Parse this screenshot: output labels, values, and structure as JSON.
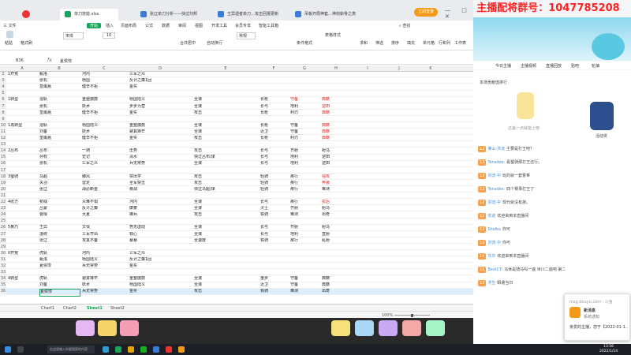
{
  "browser": {
    "tabs": [
      {
        "label": "",
        "active": false
      },
      {
        "label": "单刀技能.xlsx",
        "active": true
      },
      {
        "label": "张辽单刀分析——快过刘邦",
        "active": false
      },
      {
        "label": "王异遗者单刀…攻击回报更新",
        "active": false
      },
      {
        "label": "吊板开局神套…神剑斩骨之类",
        "active": false
      }
    ],
    "login_button": "立即登录",
    "window_controls": "— □ ✕"
  },
  "stream_banner": "主播配将群号：1047785208",
  "menu": {
    "items": [
      "三 文件",
      "开始",
      "插入",
      "页面布局",
      "公式",
      "数据",
      "审阅",
      "视图",
      "开发工具",
      "会员专享",
      "智能工具箱"
    ],
    "search": "查找"
  },
  "ribbon": {
    "labels": [
      "粘贴",
      "格式刷",
      "宋体",
      "10",
      "合并居中",
      "自动换行",
      "常规",
      "条件格式",
      "表格样式",
      "求和",
      "筛选",
      "排序",
      "填充",
      "单元格",
      "行和列",
      "工作表"
    ]
  },
  "formula_bar": {
    "cell": "B36",
    "fx": "fx",
    "value": "夏侯惇"
  },
  "columns": [
    "A",
    "B",
    "C",
    "D",
    "E",
    "F",
    "G",
    "H",
    "I",
    "J",
    "K"
  ],
  "rows": [
    {
      "n": "2",
      "a": "1开荒",
      "b": "甄洛",
      "c": "河内",
      "d": "三军之众",
      "e": "",
      "f": "",
      "g": "",
      "h": ""
    },
    {
      "n": "3",
      "a": "",
      "b": "张机",
      "c": "杨国",
      "d": "反计之策1回",
      "e": "",
      "f": "",
      "g": "",
      "h": ""
    },
    {
      "n": "4",
      "a": "",
      "b": "皇甫嵩",
      "c": "健辛不拒",
      "d": "金实",
      "e": "",
      "f": "",
      "g": "",
      "h": ""
    },
    {
      "n": "5",
      "a": "",
      "b": "",
      "c": "",
      "d": "",
      "e": "",
      "f": "",
      "g": "",
      "h": ""
    },
    {
      "n": "6",
      "a": "1转型",
      "b": "混轨",
      "c": "重整旗鼓",
      "d": "杨国陆义",
      "e": "全谋",
      "f": "长枪",
      "g": "守备",
      "h": "典籍"
    },
    {
      "n": "7",
      "a": "",
      "b": "张机",
      "c": "妖术",
      "d": "步步为营",
      "e": "全谋",
      "f": "长弓",
      "g": "地利",
      "h": "逆田"
    },
    {
      "n": "8",
      "a": "",
      "b": "皇甫嵩",
      "c": "健辛不拒",
      "d": "金实",
      "e": "攻击",
      "f": "长枪",
      "g": "利刃",
      "h": "典籍"
    },
    {
      "n": "9",
      "a": "",
      "b": "",
      "c": "",
      "d": "",
      "e": "",
      "f": "",
      "g": "",
      "h": ""
    },
    {
      "n": "10",
      "a": "1再转型",
      "b": "混轨",
      "c": "杨国陆义",
      "d": "重整旗鼓",
      "e": "全谋",
      "f": "长枪",
      "g": "守备",
      "h": "典籍"
    },
    {
      "n": "11",
      "a": "",
      "b": "刘备",
      "c": "妖术",
      "d": "避其锋芒",
      "e": "全谋",
      "f": "近卫",
      "g": "守备",
      "h": "典籍"
    },
    {
      "n": "12",
      "a": "",
      "b": "皇甫嵩",
      "c": "健辛不拒",
      "d": "金实",
      "e": "攻击",
      "f": "长枪",
      "g": "利刃",
      "h": "典籍"
    },
    {
      "n": "13",
      "a": "",
      "b": "",
      "c": "",
      "d": "",
      "e": "",
      "f": "",
      "g": "",
      "h": ""
    },
    {
      "n": "14",
      "a": "2吕布",
      "b": "吕布",
      "c": "一骑",
      "d": "击势",
      "e": "攻击",
      "f": "长弓",
      "g": "齐射",
      "h": "射马"
    },
    {
      "n": "15",
      "a": "",
      "b": "孙权",
      "c": "史记",
      "d": "清水",
      "e": "快过吕布/谋",
      "f": "长弓",
      "g": "地利",
      "h": "逆田"
    },
    {
      "n": "16",
      "a": "",
      "b": "张机",
      "c": "三军之众",
      "d": "兵无常势",
      "e": "全谋",
      "f": "长弓",
      "g": "地利",
      "h": "逆田"
    },
    {
      "n": "17",
      "a": "",
      "b": "",
      "c": "",
      "d": "",
      "e": "",
      "f": "",
      "g": "",
      "h": ""
    },
    {
      "n": "18",
      "a": "3蜀骑",
      "b": "马超",
      "c": "滕风",
      "d": "突出学",
      "e": "攻击",
      "f": "轻骑",
      "g": "疾行",
      "h": "强攻"
    },
    {
      "n": "19",
      "a": "",
      "b": "关羽",
      "c": "雷定",
      "d": "全军突击",
      "e": "攻击",
      "f": "轻骑",
      "g": "疾行",
      "h": "奔袭"
    },
    {
      "n": "20",
      "a": "",
      "b": "张辽",
      "c": "战必断金",
      "d": "疾战",
      "e": "快过马超/谋",
      "f": "轻骑",
      "g": "疾行",
      "h": "难测"
    },
    {
      "n": "21",
      "a": "",
      "b": "",
      "c": "",
      "d": "",
      "e": "",
      "f": "",
      "g": "",
      "h": ""
    },
    {
      "n": "22",
      "a": "4张方",
      "b": "荀彧",
      "c": "众难不惧",
      "d": "河内",
      "e": "全谋",
      "f": "长弓",
      "g": "疾行",
      "h": "扰后"
    },
    {
      "n": "23",
      "a": "",
      "b": "吕蒙",
      "c": "反计之策",
      "d": "康宴",
      "e": "全谋",
      "f": "灵士",
      "g": "齐射",
      "h": "射马"
    },
    {
      "n": "24",
      "a": "",
      "b": "曹操",
      "c": "大夏",
      "d": "拂兵",
      "e": "攻击",
      "f": "铁骑",
      "g": "难测",
      "h": "出奇"
    },
    {
      "n": "25",
      "a": "",
      "b": "",
      "c": "",
      "d": "",
      "e": "",
      "f": "",
      "g": "",
      "h": ""
    },
    {
      "n": "26",
      "a": "5黄乃",
      "b": "王异",
      "c": "文伐",
      "d": "势无虚动",
      "e": "全谋",
      "f": "长弓",
      "g": "齐射",
      "h": "射马"
    },
    {
      "n": "27",
      "a": "",
      "b": "凌统",
      "c": "三军齐出",
      "d": "铁心",
      "e": "全谋",
      "f": "长弓",
      "g": "地利",
      "h": "直射"
    },
    {
      "n": "28",
      "a": "",
      "b": "张辽",
      "c": "攻其不备",
      "d": "暴暴",
      "e": "全速度",
      "f": "铁骑",
      "g": "疾行",
      "h": "乱射"
    },
    {
      "n": "29",
      "a": "",
      "b": "",
      "c": "",
      "d": "",
      "e": "",
      "f": "",
      "g": "",
      "h": ""
    },
    {
      "n": "30",
      "a": "0开荒",
      "b": "虎轨",
      "c": "河内",
      "d": "三军之众",
      "e": "",
      "f": "",
      "g": "",
      "h": ""
    },
    {
      "n": "31",
      "a": "",
      "b": "甄洛",
      "c": "杨国陆义",
      "d": "反计之策1回",
      "e": "",
      "f": "",
      "g": "",
      "h": ""
    },
    {
      "n": "32",
      "a": "",
      "b": "夏侯惇",
      "c": "兵无常势",
      "d": "金实",
      "e": "",
      "f": "",
      "g": "",
      "h": ""
    },
    {
      "n": "33",
      "a": "",
      "b": "",
      "c": "",
      "d": "",
      "e": "",
      "f": "",
      "g": "",
      "h": ""
    },
    {
      "n": "34",
      "a": "4转型",
      "b": "虎轨",
      "c": "避其锋芒",
      "d": "重整旗鼓",
      "e": "全谋",
      "f": "重步",
      "g": "守备",
      "h": "典籍"
    },
    {
      "n": "35",
      "a": "",
      "b": "刘备",
      "c": "妖术",
      "d": "杨国陆义",
      "e": "全谋",
      "f": "近卫",
      "g": "守备",
      "h": "典籍"
    },
    {
      "n": "36",
      "a": "",
      "b": "夏侯惇",
      "c": "兵无常势",
      "d": "金实",
      "e": "攻击",
      "f": "铁骑",
      "g": "难测",
      "h": "出奇"
    }
  ],
  "red_cells_note": "",
  "sheets": [
    "Chart1",
    "Chart2",
    "Sheet1",
    "Sheet2"
  ],
  "active_sheet": "Sheet1",
  "status": {
    "zoom": "100%",
    "zoom_fraction": 0.5
  },
  "live": {
    "tabs": [
      "今日主播",
      "主播视频",
      "直播回放",
      "贴吧",
      "轮抽"
    ],
    "rank_title": "本场贡献值排行",
    "rank_empty": "还差一点就能上榜",
    "event_label": "活动奖",
    "messages": [
      {
        "tag": "12",
        "name": "佛山·洪流",
        "text": "主要是打王吧？"
      },
      {
        "tag": "13",
        "name": "Tensible:",
        "text": "看蜀骑那打王还行。"
      },
      {
        "tag": "12",
        "name": "洪流·中",
        "text": "玩的就一套曹奉"
      },
      {
        "tag": "13",
        "name": "Tensible:",
        "text": "四个赛事打王了"
      },
      {
        "tag": "12",
        "name": "洪流·中",
        "text": "现代就没有弟。"
      },
      {
        "tag": "12",
        "name": "欢迎",
        "text": "欢迎来到本直播间"
      },
      {
        "tag": "12",
        "name": "Shelbs",
        "text": "你可"
      },
      {
        "tag": "12",
        "name": "洪流·中",
        "text": "你可"
      },
      {
        "tag": "14",
        "name": "灰灰",
        "text": "欢迎来到本直播间"
      },
      {
        "tag": "15",
        "name": "BestCT:",
        "text": "马休是骑马吗一遍 米川二遍吧 第二"
      },
      {
        "tag": "12",
        "name": "浮生",
        "text": "瞬遣当日"
      }
    ]
  },
  "popup": {
    "source": "msg.douyu.com · 斗鱼",
    "title": "新消息",
    "sub": "系统通知",
    "body": "亲爱的主播，您于【2022-01-1…"
  },
  "taskbar": {
    "search": "在这里输入你要搜索的内容",
    "time": "13:56",
    "date": "2022/1/14"
  }
}
